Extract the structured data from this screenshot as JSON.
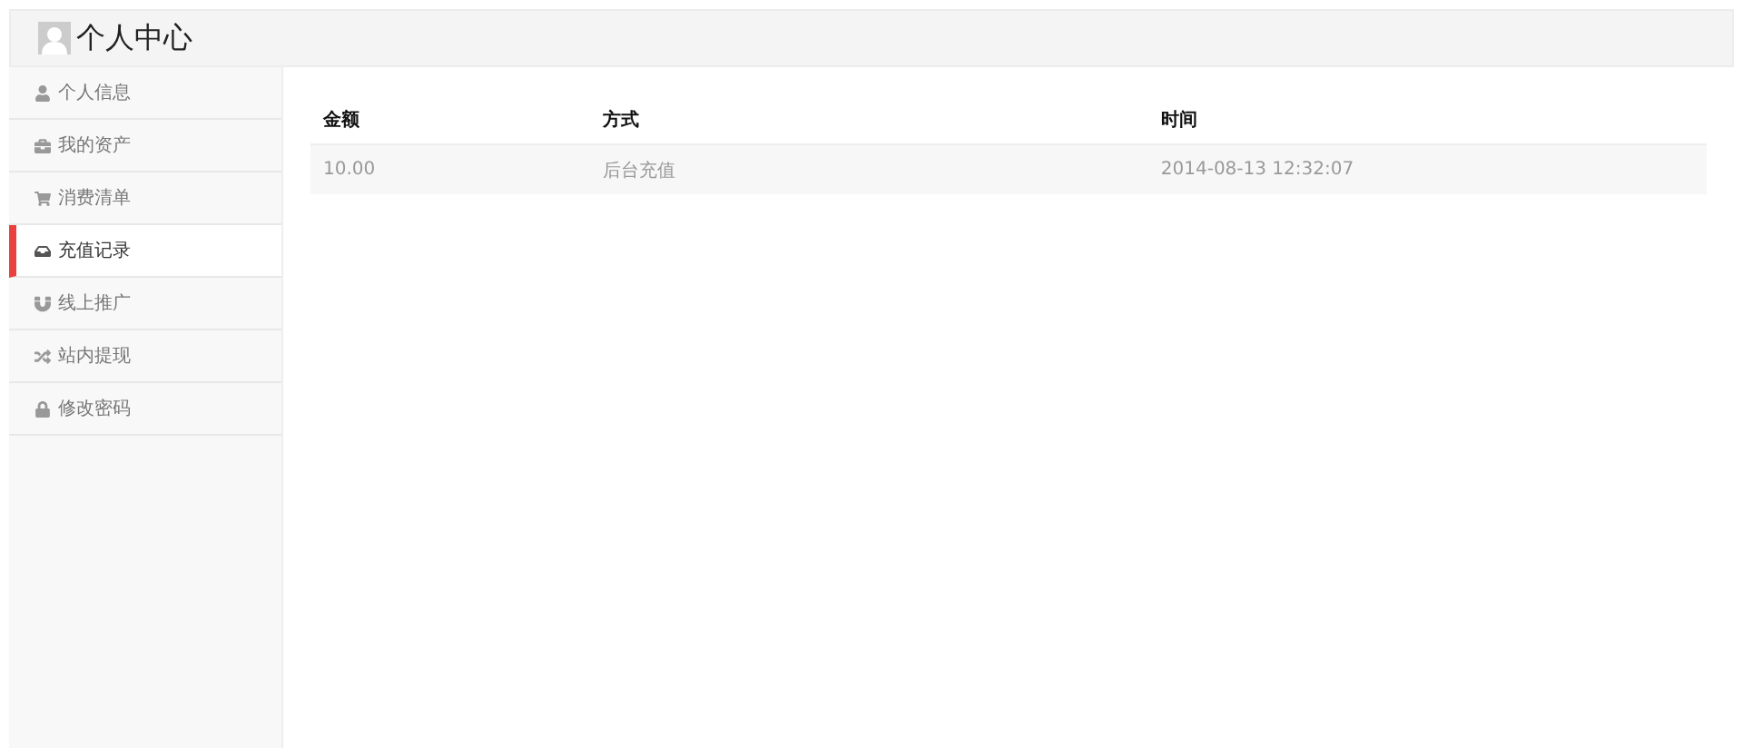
{
  "header": {
    "title": "个人中心"
  },
  "sidebar": {
    "items": [
      {
        "label": "个人信息",
        "selected": false
      },
      {
        "label": "我的资产",
        "selected": false
      },
      {
        "label": "消费清单",
        "selected": false
      },
      {
        "label": "充值记录",
        "selected": true
      },
      {
        "label": "线上推广",
        "selected": false
      },
      {
        "label": "站内提现",
        "selected": false
      },
      {
        "label": "修改密码",
        "selected": false
      }
    ]
  },
  "table": {
    "columns": [
      "金额",
      "方式",
      "时间"
    ],
    "rows": [
      [
        "10.00",
        "后台充值",
        "2014-08-13 12:32:07"
      ]
    ]
  }
}
